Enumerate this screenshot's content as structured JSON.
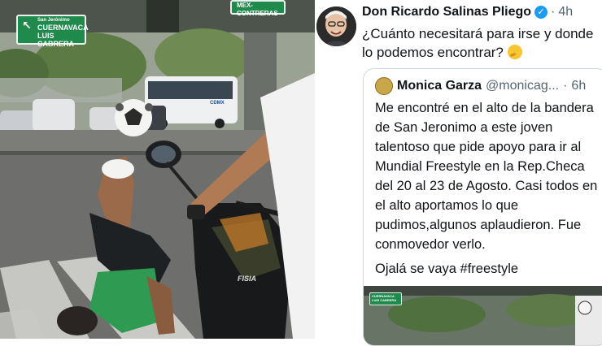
{
  "photo": {
    "sign_left": {
      "line1": "San Jerónimo",
      "line2": "CUERNAVACA",
      "line3": "LUIS CABRERA",
      "arrow": "↖"
    },
    "sign_right": {
      "text": "MEX-CONTRERAS"
    },
    "bus_logo": "CDMX",
    "moto_text": "FISIA"
  },
  "tweet": {
    "author_name": "Don Ricardo Salinas Pliego",
    "verified_icon": "✓",
    "separator": "·",
    "time": "4h",
    "text": "¿Cuánto necesitará para irse y donde lo podemos encontrar?",
    "emoji_icon": "thinking-face-emoji",
    "quote": {
      "name": "Monica Garza",
      "handle": "@monicag...",
      "separator": "·",
      "time": "6h",
      "text": "Me encontré en el alto  de la bandera de San Jeronimo a este joven talentoso que pide apoyo para ir al Mundial Freestyle en la Rep.Checa del 20 al 23 de Agosto. Casi todos en el alto aportamos lo que pudimos,algunos aplaudieron. Fue conmovedor verlo.",
      "text2": "Ojalá se vaya #freestyle",
      "media_sign": "CUERNAVACA LUIS CABRERA"
    }
  },
  "colors": {
    "accent": "#1d9bf0",
    "sign_green": "#1f8a4c",
    "text": "#0f1419",
    "muted": "#536471"
  }
}
